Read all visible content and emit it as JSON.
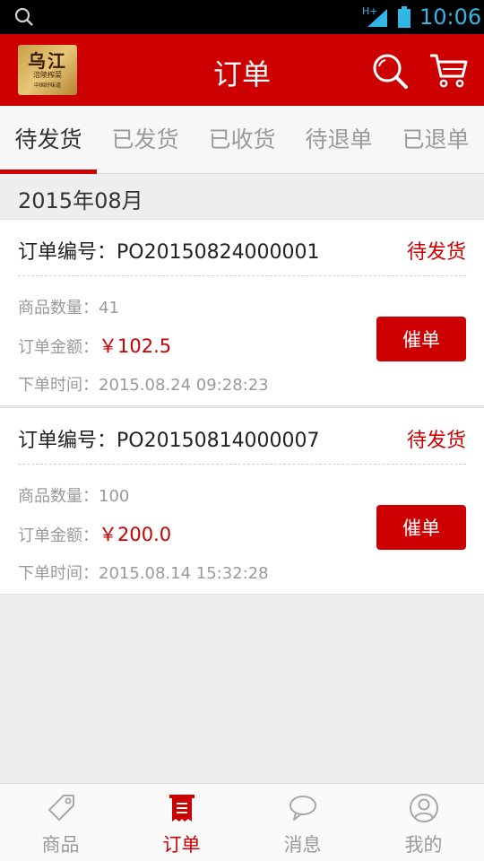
{
  "status_bar": {
    "network": "H+",
    "time": "10:06"
  },
  "header": {
    "title": "订单",
    "logo": {
      "main": "乌江",
      "sub": "涪陵榨菜",
      "tagline": "中国好味道"
    },
    "search_icon": "search-icon",
    "cart_icon": "cart-icon"
  },
  "tabs": [
    {
      "label": "待发货",
      "active": true
    },
    {
      "label": "已发货",
      "active": false
    },
    {
      "label": "已收货",
      "active": false
    },
    {
      "label": "待退单",
      "active": false
    },
    {
      "label": "已退单",
      "active": false
    }
  ],
  "month": "2015年08月",
  "orders": [
    {
      "order_no": "订单编号：PO20150824000001",
      "status": "待发货",
      "quantity_label": "商品数量：",
      "quantity": "41",
      "amount_label": "订单金额：",
      "amount": "￥102.5",
      "time_label": "下单时间：",
      "time": "2015.08.24 09:28:23",
      "action": "催单"
    },
    {
      "order_no": "订单编号：PO20150814000007",
      "status": "待发货",
      "quantity_label": "商品数量：",
      "quantity": "100",
      "amount_label": "订单金额：",
      "amount": "￥200.0",
      "time_label": "下单时间：",
      "time": "2015.08.14 15:32:28",
      "action": "催单"
    }
  ],
  "bottom_nav": [
    {
      "label": "商品",
      "icon": "tag-icon",
      "active": false
    },
    {
      "label": "订单",
      "icon": "receipt-icon",
      "active": true
    },
    {
      "label": "消息",
      "icon": "chat-bubble-icon",
      "active": false
    },
    {
      "label": "我的",
      "icon": "user-icon",
      "active": false
    }
  ],
  "colors": {
    "brand_red": "#cc0000",
    "status_blue": "#33b5e5"
  }
}
